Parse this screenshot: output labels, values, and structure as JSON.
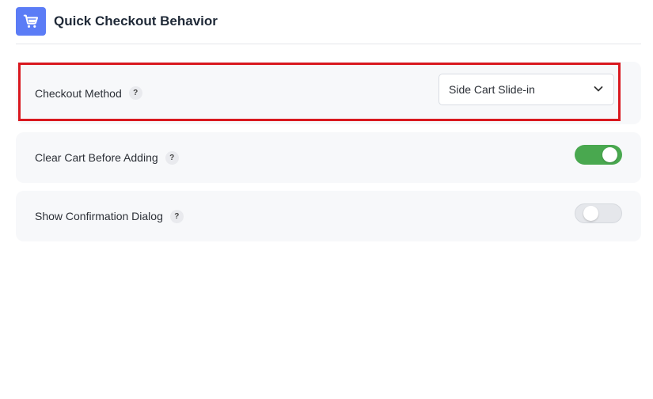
{
  "header": {
    "title": "Quick Checkout Behavior",
    "icon": "cart-icon",
    "icon_bg": "#5b7cf6"
  },
  "settings": [
    {
      "label": "Checkout Method",
      "help": "?",
      "control": "select",
      "value": "Side Cart Slide-in"
    },
    {
      "label": "Clear Cart Before Adding",
      "help": "?",
      "control": "toggle",
      "enabled": true
    },
    {
      "label": "Show Confirmation Dialog",
      "help": "?",
      "control": "toggle",
      "enabled": false
    }
  ],
  "colors": {
    "toggle_on": "#49a84f",
    "toggle_off": "#e5e7eb",
    "highlight": "#d9181f"
  }
}
